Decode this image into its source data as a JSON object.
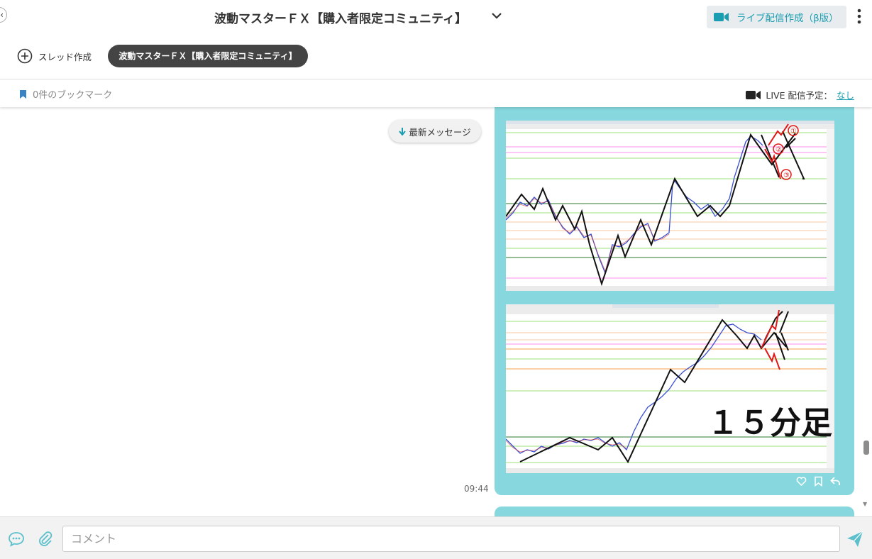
{
  "header": {
    "title": "波動マスターＦＸ【購入者限定コミュニティ】",
    "live_create_label": "ライブ配信作成（β版）"
  },
  "thread_bar": {
    "new_thread_label": "スレッド作成",
    "active_thread_label": "波動マスターＦＸ【購入者限定コミュニティ】"
  },
  "bookmark_bar": {
    "bookmark_label": "0件のブックマーク",
    "live_schedule_label": "LIVE 配信予定：",
    "live_schedule_value": "なし"
  },
  "main": {
    "latest_messages_label": "最新メッセージ",
    "message": {
      "time": "09:44",
      "image2_caption": "１５分足",
      "annotation_labels": [
        "①",
        "②",
        "③"
      ]
    }
  },
  "composer": {
    "placeholder": "コメント"
  },
  "colors": {
    "accent": "#1a9db0",
    "bubble": "#86d8de",
    "pill": "#444444"
  },
  "icons": [
    "back-icon",
    "chevron-down-icon",
    "video-camera-icon",
    "kebab-menu-icon",
    "plus-circle-icon",
    "bookmark-icon",
    "arrow-down-icon",
    "heart-icon",
    "bookmark-outline-icon",
    "reply-icon",
    "chat-bubble-icon",
    "paperclip-icon",
    "send-icon"
  ]
}
